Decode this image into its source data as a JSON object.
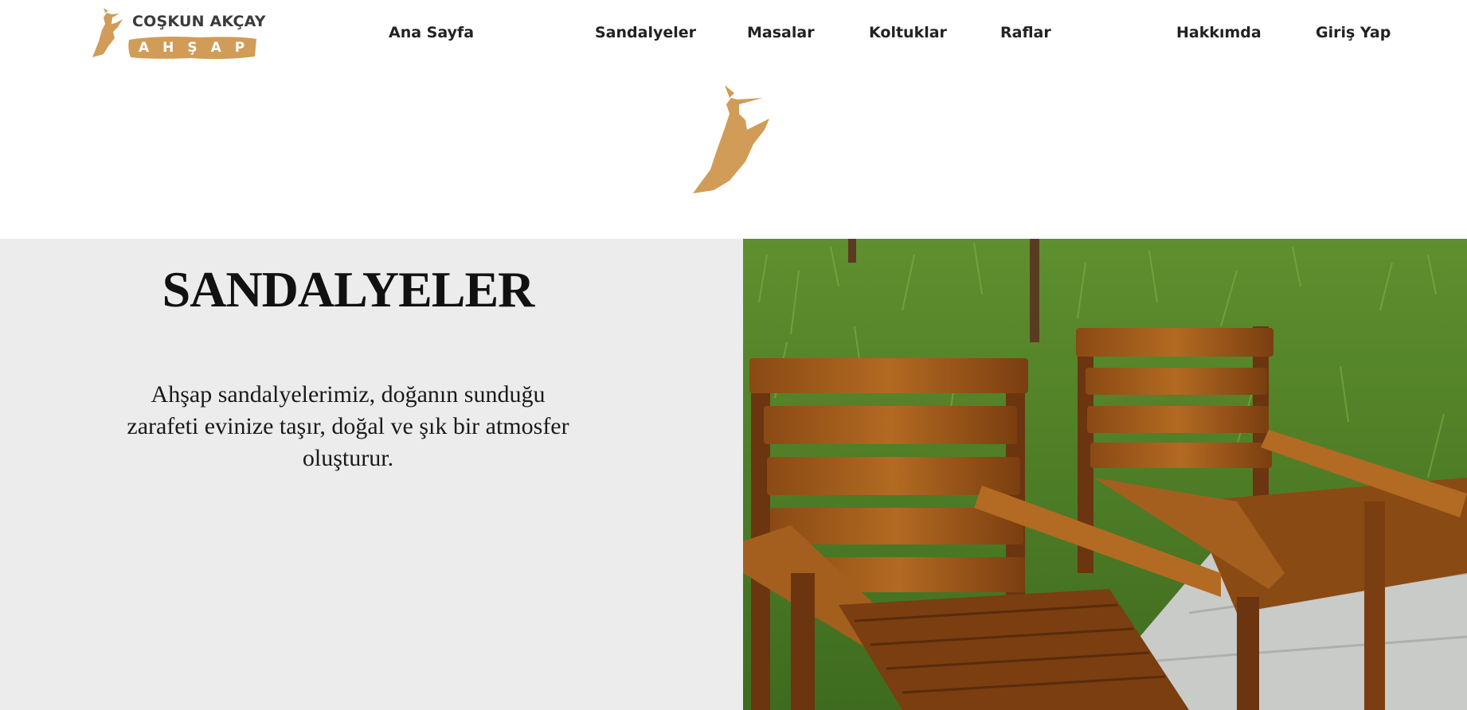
{
  "brand": {
    "name_top": "COŞKUN AKÇAY",
    "name_bottom": "AHŞAP",
    "accent_color": "#d09c57"
  },
  "nav": {
    "home": "Ana Sayfa",
    "chairs": "Sandalyeler",
    "tables": "Masalar",
    "armchairs": "Koltuklar",
    "shelves": "Raflar",
    "about": "Hakkımda",
    "login": "Giriş Yap"
  },
  "hero": {
    "title": "SANDALYELER",
    "description": "Ahşap sandalyelerimiz, doğanın sunduğu zarafeti evinize taşır, doğal ve şık bir atmosfer oluşturur.",
    "image_icon": "wooden-chairs-photo"
  },
  "icons": {
    "logo": "woodpecker-icon",
    "center": "woodpecker-icon"
  }
}
